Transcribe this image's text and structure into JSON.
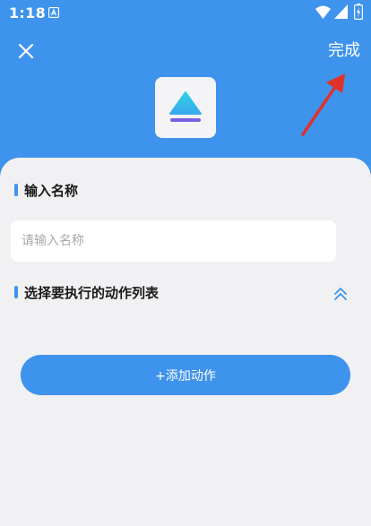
{
  "status_bar": {
    "time": "1:18",
    "icons": [
      "notification-icon",
      "wifi-icon",
      "signal-icon",
      "battery-icon"
    ]
  },
  "header": {
    "close_icon": "close-icon",
    "done_label": "完成",
    "app_icon": "eject-triangle-icon",
    "background_color": "#3e93ec"
  },
  "form": {
    "name_section": {
      "title": "输入名称"
    },
    "name_input": {
      "placeholder": "请输入名称",
      "value": ""
    },
    "actions_section": {
      "title": "选择要执行的动作列表",
      "toggle_icon": "double-chevron-up-icon"
    },
    "add_action_label": "+添加动作"
  },
  "colors": {
    "accent": "#3e93ec",
    "card_background": "#f1f1f4",
    "annotation_arrow": "#e0312a"
  }
}
